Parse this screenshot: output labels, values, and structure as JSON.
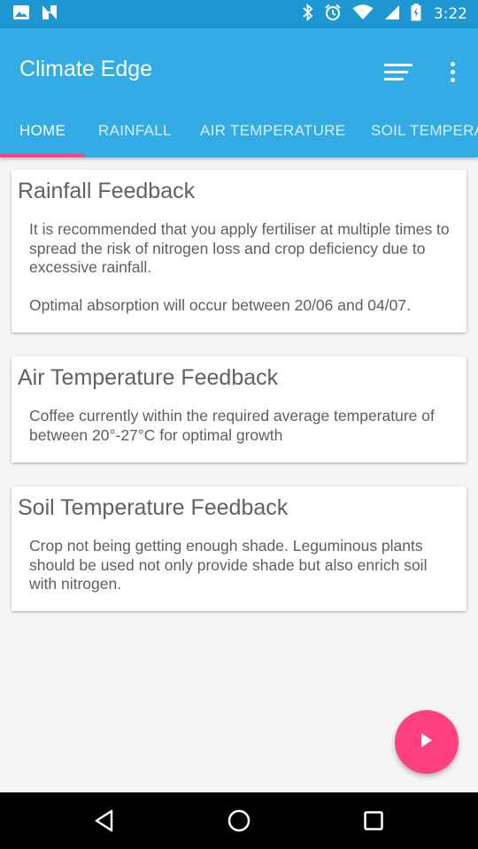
{
  "status_bar": {
    "time": "3:22",
    "left_icons": [
      "image-icon",
      "n-icon"
    ],
    "right_icons": [
      "bluetooth-icon",
      "alarm-icon",
      "wifi-icon",
      "signal-icon",
      "battery-icon"
    ]
  },
  "app_bar": {
    "title": "Climate Edge",
    "actions": [
      "sort-icon",
      "more-vert-icon"
    ]
  },
  "tabs": [
    {
      "label": "HOME",
      "active": true
    },
    {
      "label": "RAINFALL",
      "active": false
    },
    {
      "label": "AIR TEMPERATURE",
      "active": false
    },
    {
      "label": "SOIL TEMPERA",
      "active": false
    }
  ],
  "cards": [
    {
      "title": "Rainfall Feedback",
      "paragraphs": [
        "It is recommended that you apply fertiliser at multiple times to spread the risk of nitrogen loss and crop deficiency due to excessive rainfall.",
        "Optimal absorption will occur between 20/06 and 04/07."
      ]
    },
    {
      "title": "Air Temperature Feedback",
      "paragraphs": [
        "Coffee currently within the required average temperature of between 20°-27°C for optimal growth"
      ]
    },
    {
      "title": "Soil Temperature Feedback",
      "paragraphs": [
        "Crop not being getting enough shade. Leguminous plants should be used not only provide shade but also enrich soil with nitrogen."
      ]
    }
  ],
  "fab": {
    "icon": "play-icon"
  },
  "nav_bar": {
    "buttons": [
      "back-icon",
      "home-icon",
      "recents-icon"
    ]
  },
  "colors": {
    "status_bar": "#1e96d2",
    "app_bar": "#33ace6",
    "accent": "#ff4081",
    "background": "#f5f5f5"
  }
}
